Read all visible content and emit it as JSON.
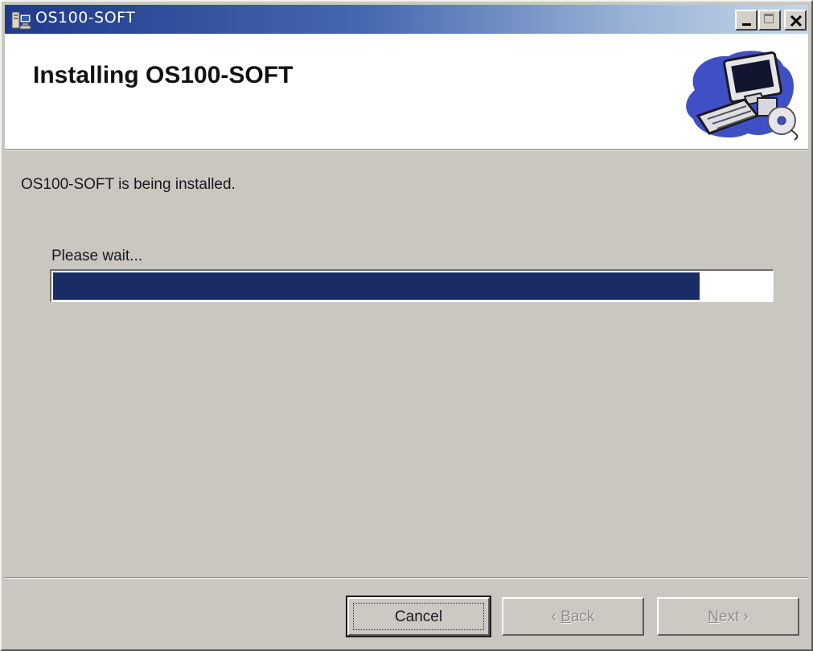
{
  "window": {
    "title": "OS100-SOFT",
    "controls": {
      "minimize": "minimize-icon",
      "maximize": "maximize-icon",
      "close": "close-icon"
    }
  },
  "header": {
    "title": "Installing OS100-SOFT",
    "graphic": "computer-setup-icon"
  },
  "body": {
    "status_text": "OS100-SOFT is being installed.",
    "wait_label": "Please wait...",
    "progress_percent": 90
  },
  "buttons": {
    "cancel": {
      "label": "Cancel",
      "enabled": true,
      "focused": true
    },
    "back": {
      "arrow": "‹",
      "mnemonic": "B",
      "rest": "ack",
      "enabled": false
    },
    "next": {
      "mnemonic": "N",
      "rest": "ext",
      "arrow": "›",
      "enabled": false
    }
  },
  "colors": {
    "title_bar_start": "#1f3a8a",
    "title_bar_end": "#c6d6e8",
    "progress_fill": "#192c64",
    "dialog_face": "#c9c7c0"
  }
}
